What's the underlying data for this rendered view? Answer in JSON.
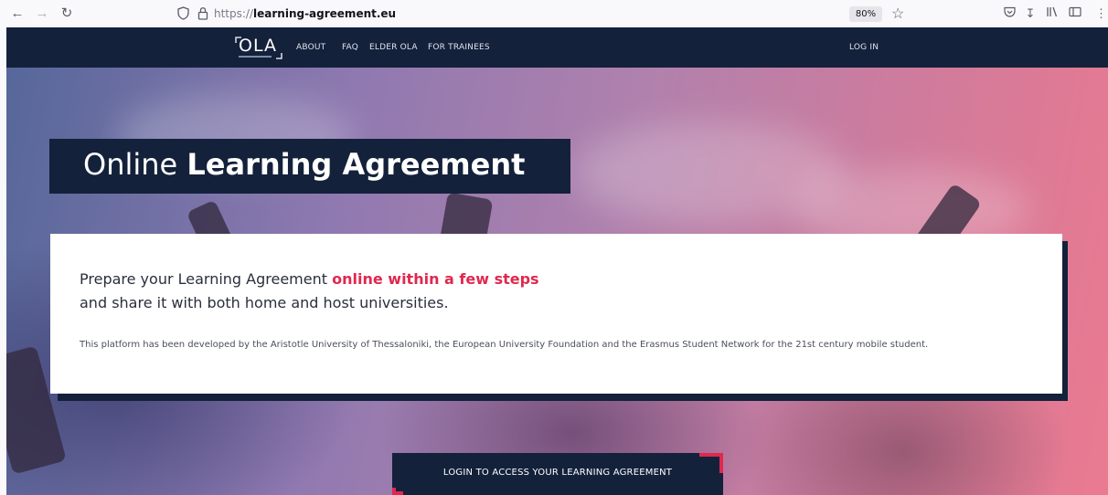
{
  "browser": {
    "url_prefix": "https://",
    "url_domain": "learning-agreement.eu",
    "zoom": "80%"
  },
  "navbar": {
    "logo": "OLA",
    "links": [
      "ABOUT",
      "FAQ",
      "ELDER OLA",
      "FOR TRAINEES"
    ],
    "login": "LOG IN"
  },
  "hero": {
    "title_light": "Online",
    "title_bold": "Learning Agreement",
    "lead_prefix": "Prepare your Learning Agreement",
    "lead_accent": "online within a few steps",
    "lead_line2": "and share it with both home and host universities.",
    "description": "This platform has been developed by the Aristotle University of Thessaloniki, the European University Foundation and the Erasmus Student Network for the 21st century mobile student.",
    "login_button": "LOGIN TO ACCESS YOUR LEARNING AGREEMENT"
  },
  "colors": {
    "navy": "#14213b",
    "accent": "#e0284f"
  },
  "icons": [
    "back-icon",
    "forward-icon",
    "reload-icon",
    "shield-icon",
    "lock-icon",
    "star-icon",
    "pocket-icon",
    "download-icon",
    "library-icon",
    "sidebar-icon"
  ]
}
